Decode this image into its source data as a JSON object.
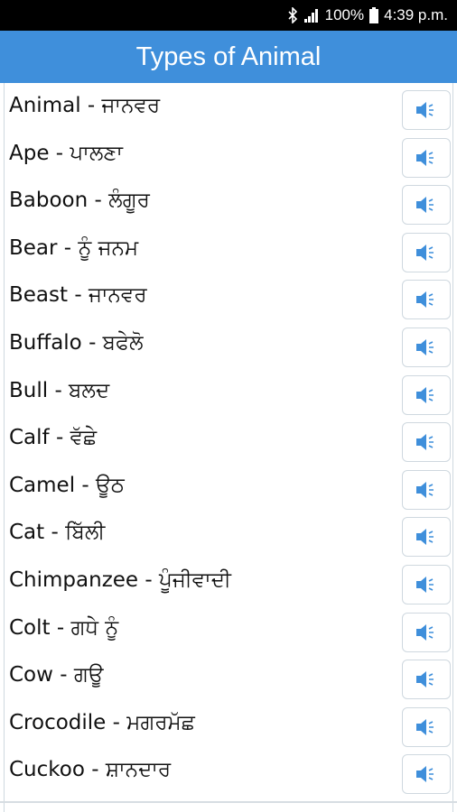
{
  "status_bar": {
    "battery": "100%",
    "time": "4:39 p.m.",
    "icons": [
      "bluetooth-icon",
      "signal-icon",
      "battery-icon"
    ]
  },
  "header": {
    "title": "Types of Animal",
    "color": "#3f8fdb"
  },
  "list": {
    "items": [
      {
        "text": " Animal - ਜਾਨਵਰ"
      },
      {
        "text": "Ape - ਪਾਲਣਾ"
      },
      {
        "text": "Baboon - ਲੰਗੂਰ"
      },
      {
        "text": "Bear - ਨੂੰ ਜਨਮ"
      },
      {
        "text": "Beast - ਜਾਨਵਰ"
      },
      {
        "text": "Buffalo - ਬਫੇਲੋ"
      },
      {
        "text": "Bull - ਬਲਦ"
      },
      {
        "text": "Calf - ਵੱਛੇ"
      },
      {
        "text": "Camel - ਊਠ"
      },
      {
        "text": "Cat - ਬਿੱਲੀ"
      },
      {
        "text": "Chimpanzee - ਪੂੰਜੀਵਾਦੀ"
      },
      {
        "text": "Colt - ਗਧੇ ਨੂੰ"
      },
      {
        "text": "Cow - ਗਊ"
      },
      {
        "text": "Crocodile - ਮਗਰਮੱਛ"
      },
      {
        "text": "Cuckoo - ਸ਼ਾਨਦਾਰ"
      }
    ],
    "button_icon": "speaker-icon",
    "icon_color": "#3f8fdb"
  }
}
